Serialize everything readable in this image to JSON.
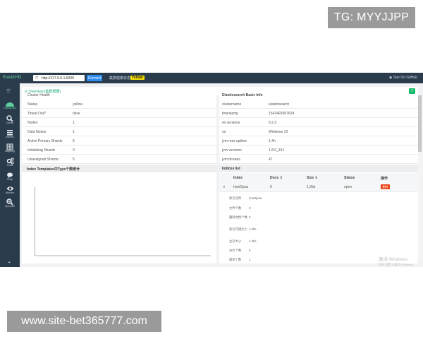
{
  "watermarks": {
    "top": "TG: MYYJJPP",
    "bottom": "www.site-bet365777.com"
  },
  "topbar": {
    "brand": "ElasticHD",
    "url_value": "http://127.0.0.1:9200",
    "connect_label": "Connect",
    "health_label": "集群健康状态：",
    "health_value": "Yellow",
    "star_label": "Star On GitHub"
  },
  "sidebar": {
    "items": [
      {
        "label": "Dashboard",
        "icon": "dashboard-icon"
      },
      {
        "label": "Query",
        "icon": "search-icon"
      },
      {
        "label": "Indices",
        "icon": "list-icon"
      },
      {
        "label": "Mapping",
        "icon": "table-icon"
      },
      {
        "label": "Tools",
        "icon": "cogs-icon"
      },
      {
        "label": "Help",
        "icon": "chat-icon"
      },
      {
        "label": "Monitor",
        "icon": "eye-icon"
      },
      {
        "label": "QueryAll",
        "icon": "zoom-icon"
      }
    ]
  },
  "overview": {
    "title": "Overview [集群概要]",
    "add_label": "+"
  },
  "cluster": {
    "header_cut": "Cluster Health",
    "rows": [
      {
        "k": "Status",
        "v": "yellow"
      },
      {
        "k": "Timed Out?",
        "v": "false"
      },
      {
        "k": "Nodes",
        "v": "1"
      },
      {
        "k": "Data Nodes",
        "v": "1"
      },
      {
        "k": "Active Primary Shards",
        "v": "5"
      },
      {
        "k": "Initializing Shards",
        "v": "0"
      },
      {
        "k": "Unassigned Shards",
        "v": "5"
      }
    ]
  },
  "index_templates": {
    "title": "Index Templates中Type个数统计"
  },
  "basic": {
    "header_cut": "Elasticsearch Basic Info",
    "rows": [
      {
        "k": "clustername",
        "v": "elasticsearch"
      },
      {
        "k": "timestamp",
        "v": "1543492087624"
      },
      {
        "k": "es versions",
        "v": "6.2.2"
      },
      {
        "k": "os",
        "v": "Windows 10"
      },
      {
        "k": "jvm max uptime",
        "v": "1.4h"
      },
      {
        "k": "jvm versions",
        "v": "1.8.0_151"
      },
      {
        "k": "jvm threads",
        "v": "47"
      }
    ]
  },
  "indices": {
    "title": "Indices list",
    "columns": {
      "index": "Index",
      "docs": "Docs ⇕",
      "size": "Size ⇕",
      "status": "Status",
      "op": "操作"
    },
    "row": {
      "expand": "∨",
      "index": "how2java",
      "docs": "0",
      "size": "1.2kb",
      "status": "open",
      "delete": "删除"
    },
    "details": [
      {
        "k": "索引名称",
        "v": "how2java"
      },
      {
        "k": "文件个数",
        "v": "0"
      },
      {
        "k": "删除文档个数",
        "v": "0"
      },
      {
        "k": "索引存储大小",
        "v": "1.2kb"
      },
      {
        "k": "主存大小",
        "v": "1.2kb"
      },
      {
        "k": "分片个数",
        "v": "5"
      },
      {
        "k": "副本个数",
        "v": "1"
      }
    ]
  },
  "windows_watermark": {
    "line1": "激活 Windows",
    "line2": "转到\"设置\"以激活 Windows。"
  },
  "colors": {
    "sidebar": "#2a3b4c",
    "accent": "#19be6b",
    "primary": "#2d8cf0",
    "danger": "#ed4014",
    "health": "#f5e100"
  }
}
